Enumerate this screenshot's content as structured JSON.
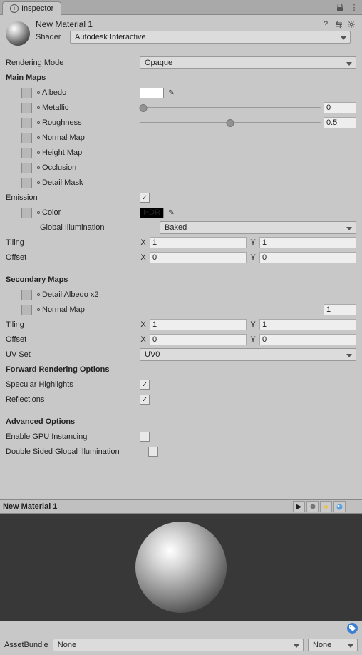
{
  "tab": {
    "label": "Inspector"
  },
  "header": {
    "title": "New Material 1",
    "shader_label": "Shader",
    "shader_value": "Autodesk Interactive"
  },
  "rendering_mode": {
    "label": "Rendering Mode",
    "value": "Opaque"
  },
  "main_maps": {
    "heading": "Main Maps",
    "albedo": "Albedo",
    "metallic": {
      "label": "Metallic",
      "value": "0",
      "pos": 0
    },
    "roughness": {
      "label": "Roughness",
      "value": "0.5",
      "pos": 50
    },
    "normal": "Normal Map",
    "height": "Height Map",
    "occlusion": "Occlusion",
    "detail_mask": "Detail Mask",
    "emission": "Emission",
    "color": "Color",
    "hdr": "HDR",
    "gi_label": "Global Illumination",
    "gi_value": "Baked",
    "tiling": "Tiling",
    "tiling_x": "1",
    "tiling_y": "1",
    "offset": "Offset",
    "offset_x": "0",
    "offset_y": "0"
  },
  "secondary": {
    "heading": "Secondary Maps",
    "detail_albedo": "Detail Albedo x2",
    "normal": "Normal Map",
    "normal_val": "1",
    "tiling": "Tiling",
    "tiling_x": "1",
    "tiling_y": "1",
    "offset": "Offset",
    "offset_x": "0",
    "offset_y": "0",
    "uvset_label": "UV Set",
    "uvset_value": "UV0"
  },
  "forward": {
    "heading": "Forward Rendering Options",
    "specular": "Specular Highlights",
    "reflections": "Reflections"
  },
  "advanced": {
    "heading": "Advanced Options",
    "gpu": "Enable GPU Instancing",
    "double": "Double Sided Global Illumination"
  },
  "preview": {
    "title": "New Material 1"
  },
  "bundle": {
    "label": "AssetBundle",
    "main": "None",
    "variant": "None"
  },
  "x": "X",
  "y": "Y"
}
